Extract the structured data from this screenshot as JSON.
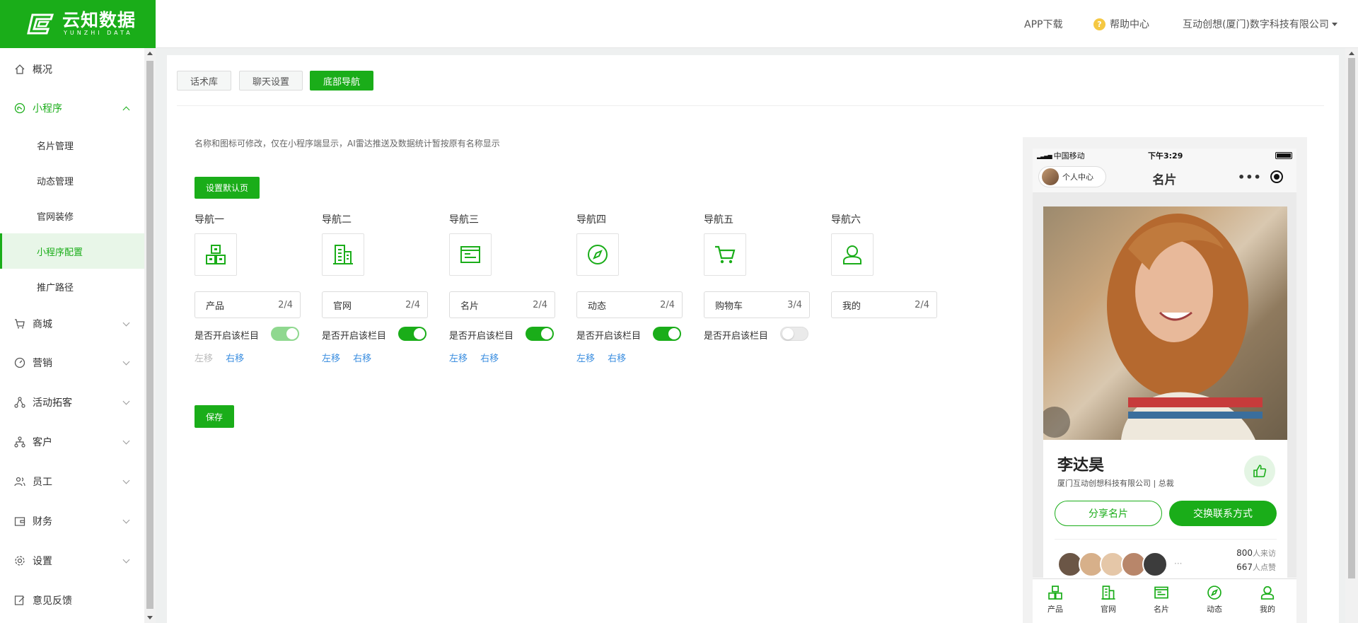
{
  "brand": {
    "name": "云知数据",
    "sub": "YUNZHI DATA"
  },
  "header": {
    "app_download": "APP下载",
    "help_center": "帮助中心",
    "company": "互动创想(厦门)数字科技有限公司"
  },
  "sidebar": {
    "overview": "概况",
    "miniprogram": "小程序",
    "sub_items": [
      "名片管理",
      "动态管理",
      "官网装修",
      "小程序配置",
      "推广路径"
    ],
    "mall": "商城",
    "marketing": "营销",
    "activity": "活动拓客",
    "customer": "客户",
    "staff": "员工",
    "finance": "财务",
    "settings": "设置",
    "feedback": "意见反馈"
  },
  "tabs": [
    "话术库",
    "聊天设置",
    "底部导航"
  ],
  "hint": "名称和图标可修改，仅在小程序端显示，AI雷达推送及数据统计暂按原有名称显示",
  "set_default_label": "设置默认页",
  "save_label": "保存",
  "switch_label": "是否开启该栏目",
  "move_left": "左移",
  "move_right": "右移",
  "navs": [
    {
      "title": "导航一",
      "name": "产品",
      "count": "2/4",
      "enabled": true
    },
    {
      "title": "导航二",
      "name": "官网",
      "count": "2/4",
      "enabled": true
    },
    {
      "title": "导航三",
      "name": "名片",
      "count": "2/4",
      "enabled": true
    },
    {
      "title": "导航四",
      "name": "动态",
      "count": "2/4",
      "enabled": true
    },
    {
      "title": "导航五",
      "name": "购物车",
      "count": "3/4",
      "enabled": false
    },
    {
      "title": "导航六",
      "name": "我的",
      "count": "2/4"
    }
  ],
  "phone": {
    "carrier": "中国移动",
    "time": "下午3:29",
    "personal_center": "个人中心",
    "page_title": "名片",
    "person_name": "李达昊",
    "company_title": "厦门互动创想科技有限公司 | 总裁",
    "share_card": "分享名片",
    "exchange_contact": "交换联系方式",
    "visitors_num": "800",
    "visitors_text": "人来访",
    "likes_num": "667",
    "likes_text": "人点赞",
    "ellipsis": "···",
    "tabbar": [
      "产品",
      "官网",
      "名片",
      "动态",
      "我的"
    ]
  },
  "colors": {
    "accent": "#1aad19",
    "link": "#3d8fe0"
  }
}
